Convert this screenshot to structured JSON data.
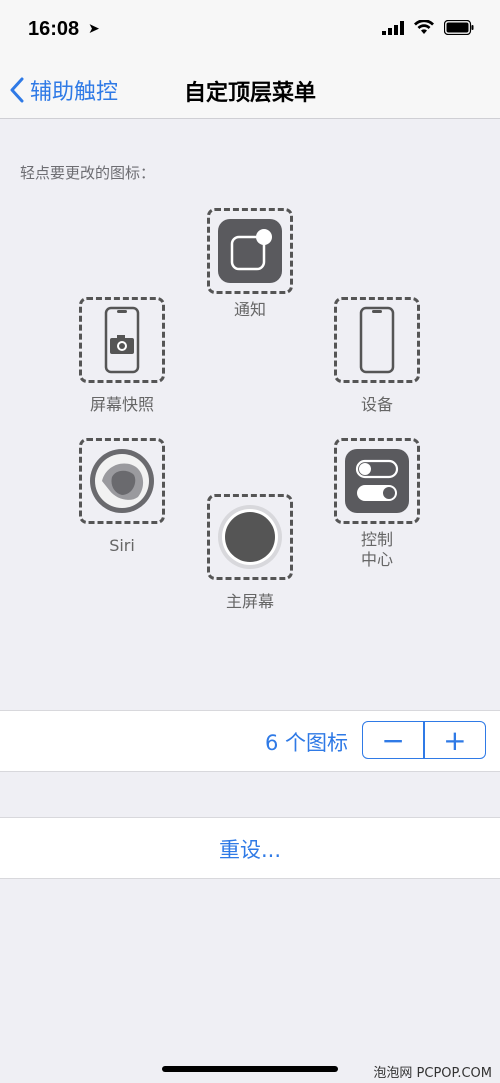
{
  "status": {
    "time": "16:08"
  },
  "nav": {
    "back_label": "辅助触控",
    "title": "自定顶层菜单"
  },
  "hint": "轻点要更改的图标：",
  "icons": {
    "notification": "通知",
    "screenshot": "屏幕快照",
    "device": "设备",
    "siri": "Siri",
    "home": "主屏幕",
    "control_center": "控制\n中心"
  },
  "count": {
    "label": "6 个图标",
    "minus": "−",
    "plus": "+"
  },
  "reset": "重设...",
  "watermark": "泡泡网 PCPOP.COM",
  "colors": {
    "accent": "#2f7ae6",
    "background": "#efeff4",
    "icon_dark": "#5a5a5e"
  }
}
